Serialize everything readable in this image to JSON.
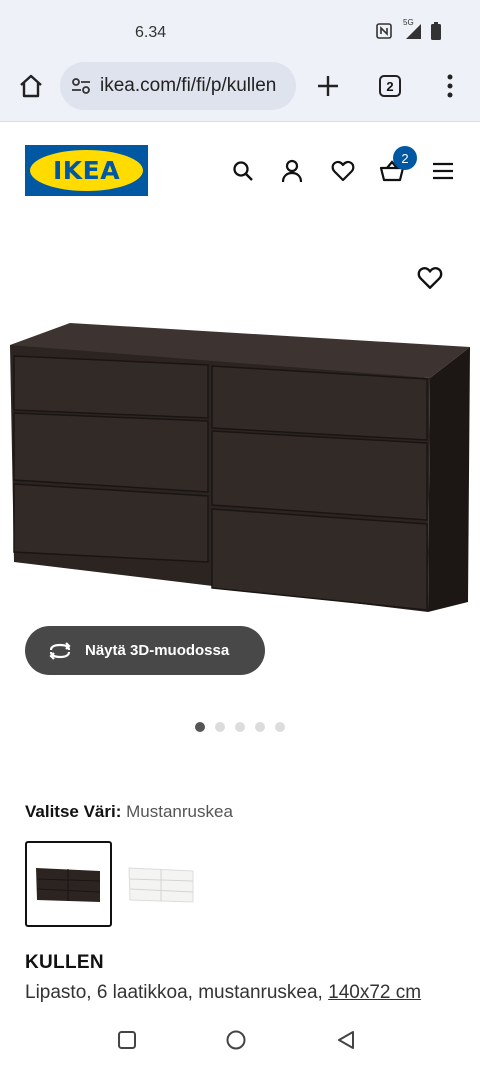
{
  "status": {
    "time": "6.34",
    "network": "5G"
  },
  "browser": {
    "url": "ikea.com/fi/fi/p/kullen",
    "tab_count": "2"
  },
  "header": {
    "logo_text": "IKEA",
    "cart_count": "2"
  },
  "gallery": {
    "view3d_label": "Näytä 3D-muodossa",
    "total_images": 5,
    "active_index": 0
  },
  "color_picker": {
    "label": "Valitse Väri:",
    "selected_value": "Mustanruskea",
    "options": [
      {
        "name": "mustanruskea",
        "color": "#2b2421",
        "selected": true
      },
      {
        "name": "valkoinen",
        "color": "#f4f4f2",
        "selected": false
      }
    ]
  },
  "product": {
    "name": "KULLEN",
    "description": "Lipasto, 6 laatikkoa, mustanruskea,",
    "dimensions": "140x72 cm"
  },
  "colors": {
    "brand_blue": "#0058a3",
    "brand_yellow": "#ffdb00",
    "dresser": "#2b2421"
  }
}
